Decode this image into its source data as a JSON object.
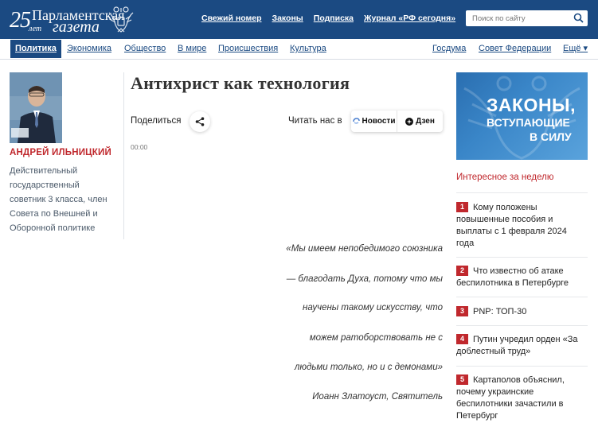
{
  "header": {
    "logo": {
      "number": "25",
      "years": "лет",
      "line1": "Парламентская",
      "line2": "газета"
    },
    "links": [
      "Свежий номер",
      "Законы",
      "Подписка",
      "Журнал «РФ сегодня»"
    ],
    "search_placeholder": "Поиск по сайту",
    "colors": {
      "header_bg": "#1b4a82",
      "accent_red": "#c0282d"
    }
  },
  "nav": {
    "items": [
      "Политика",
      "Экономика",
      "Общество",
      "В мире",
      "Происшествия",
      "Культура"
    ],
    "right_items": [
      "Госдума",
      "Совет Федерации",
      "Ещё ▾"
    ],
    "active": "Политика"
  },
  "author": {
    "name": "АНДРЕЙ ИЛЬНИЦКИЙ",
    "description_lines": [
      "Действительный",
      "государственный",
      "советник 3 класса, член",
      "Совета по Внешней и",
      "Оборонной политике"
    ]
  },
  "article": {
    "title": "Антихрист как технология",
    "share_label": "Поделиться",
    "read_label": "Читать нас в",
    "read_buttons": [
      "Новости",
      "Дзен"
    ],
    "timecode": "00:00",
    "epigraph_lines": [
      "«Мы имеем непобедимого союзника",
      "— благодать Духа, потому что мы",
      "научены такому искусству, что",
      "можем ратоборствовать не с",
      "людьми только, но и с демонами»",
      "Иоанн Златоуст, Святитель"
    ]
  },
  "sidebar": {
    "banner_lines": [
      "ЗАКОНЫ,",
      "ВСТУПАЮЩИЕ",
      "В СИЛУ"
    ],
    "heading": "Интересное за неделю",
    "items": [
      {
        "num": "1",
        "lines": [
          "Кому положены",
          "повышенные пособия и",
          "выплаты с 1 февраля 2024",
          "года"
        ]
      },
      {
        "num": "2",
        "lines": [
          "Что известно об атаке",
          "беспилотника в Петербурге"
        ]
      },
      {
        "num": "3",
        "lines": [
          "PNP: ТОП-30"
        ]
      },
      {
        "num": "4",
        "lines": [
          "Путин учредил орден «За",
          "доблестный труд»"
        ]
      },
      {
        "num": "5",
        "lines": [
          "Картаполов объяснил,",
          "почему украинские",
          "беспилотники зачастили в",
          "Петербург"
        ]
      }
    ]
  }
}
